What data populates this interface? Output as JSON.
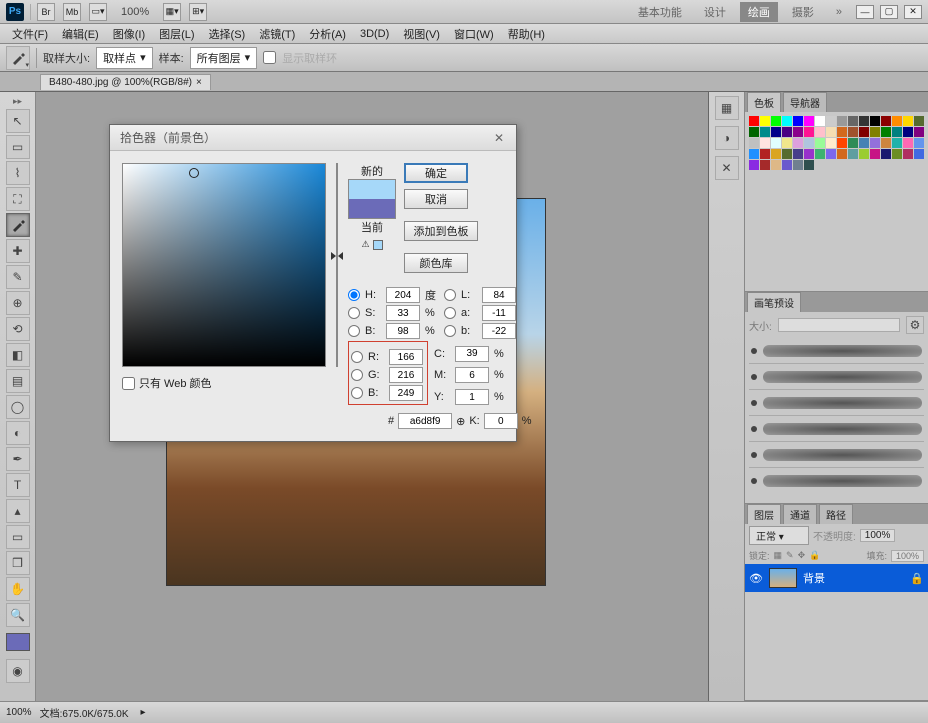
{
  "app": {
    "logo": "Ps"
  },
  "topbar": {
    "zoom": "100%",
    "tabs": [
      "基本功能",
      "设计",
      "绘画",
      "摄影"
    ],
    "active_tab": 2,
    "more": "»"
  },
  "menu": [
    "文件(F)",
    "编辑(E)",
    "图像(I)",
    "图层(L)",
    "选择(S)",
    "滤镜(T)",
    "分析(A)",
    "3D(D)",
    "视图(V)",
    "窗口(W)",
    "帮助(H)"
  ],
  "options": {
    "label1": "取样大小:",
    "value1": "取样点",
    "label2": "样本:",
    "value2": "所有图层",
    "check_label": "显示取样环"
  },
  "doc_tab": "B480-480.jpg @ 100%(RGB/8#)",
  "status": {
    "zoom": "100%",
    "doc": "文档:675.0K/675.0K"
  },
  "panels": {
    "swatches": {
      "tabs": [
        "色板",
        "导航器"
      ]
    },
    "brushes": {
      "title": "画笔预设",
      "size_label": "大小:"
    },
    "layers": {
      "tabs": [
        "图层",
        "通道",
        "路径"
      ],
      "blend": "正常",
      "opacity_label": "不透明度:",
      "opacity": "100%",
      "lock_label": "锁定:",
      "fill_label": "填充:",
      "fill": "100%",
      "layer_name": "背景"
    }
  },
  "swatch_colors": [
    "#ff0000",
    "#ffff00",
    "#00ff00",
    "#00ffff",
    "#0000ff",
    "#ff00ff",
    "#ffffff",
    "#cccccc",
    "#999999",
    "#666666",
    "#333333",
    "#000000",
    "#8b0000",
    "#ff8c00",
    "#ffd700",
    "#556b2f",
    "#006400",
    "#008b8b",
    "#00008b",
    "#4b0082",
    "#8b008b",
    "#ff1493",
    "#ffc0cb",
    "#f5deb3",
    "#d2691e",
    "#a0522d",
    "#800000",
    "#808000",
    "#008000",
    "#008080",
    "#000080",
    "#800080",
    "#c0c0c0",
    "#ffe4e1",
    "#e0ffff",
    "#f0e68c",
    "#dda0dd",
    "#b0c4de",
    "#98fb98",
    "#ffebcd",
    "#ff4500",
    "#2e8b57",
    "#4682b4",
    "#9370db",
    "#cd853f",
    "#20b2aa",
    "#ff69b4",
    "#6495ed",
    "#1e90ff",
    "#b22222",
    "#daa520",
    "#556b2f",
    "#483d8b",
    "#9932cc",
    "#3cb371",
    "#7b68ee",
    "#d2691e",
    "#5f9ea0",
    "#9acd32",
    "#c71585",
    "#191970",
    "#6b8e23",
    "#b03060",
    "#4169e1",
    "#8a2be2",
    "#a52a2a",
    "#deb887",
    "#6a5acd",
    "#708090",
    "#2f4f4f"
  ],
  "picker": {
    "title": "拾色器（前景色）",
    "new_label": "新的",
    "cur_label": "当前",
    "btn_ok": "确定",
    "btn_cancel": "取消",
    "btn_add": "添加到色板",
    "btn_lib": "颜色库",
    "web_only": "只有 Web 颜色",
    "H": "204",
    "H_unit": "度",
    "S": "33",
    "B": "98",
    "L": "84",
    "a": "-11",
    "b": "-22",
    "R": "166",
    "G": "216",
    "Bb": "249",
    "C": "39",
    "M": "6",
    "Y": "1",
    "K": "0",
    "percent": "%",
    "hex": "a6d8f9",
    "labels": {
      "H": "H:",
      "S": "S:",
      "B": "B:",
      "L": "L:",
      "a": "a:",
      "b": "b:",
      "R": "R:",
      "G": "G:",
      "Bb": "B:",
      "C": "C:",
      "M": "M:",
      "Y": "Y:",
      "K": "K:"
    }
  },
  "fg_color": "#6b6bb8"
}
